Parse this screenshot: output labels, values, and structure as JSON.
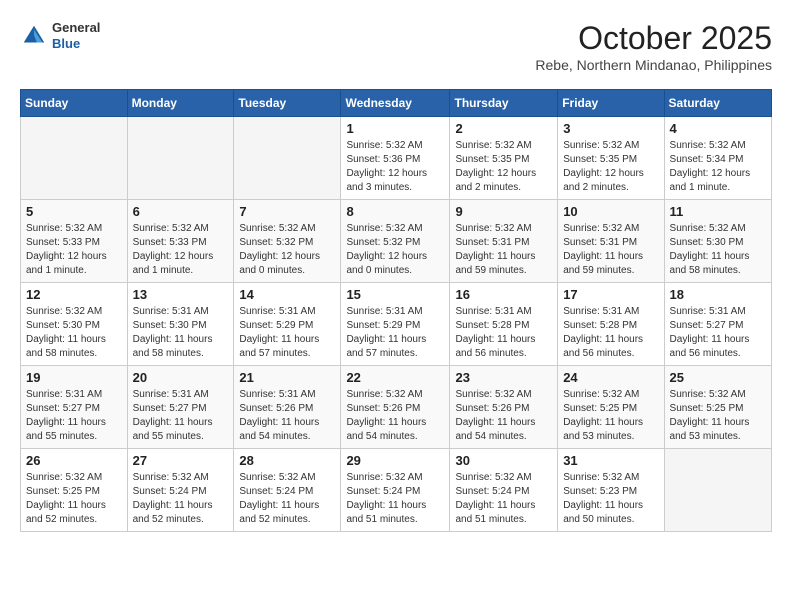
{
  "header": {
    "logo_general": "General",
    "logo_blue": "Blue",
    "month_year": "October 2025",
    "location": "Rebe, Northern Mindanao, Philippines"
  },
  "weekdays": [
    "Sunday",
    "Monday",
    "Tuesday",
    "Wednesday",
    "Thursday",
    "Friday",
    "Saturday"
  ],
  "weeks": [
    [
      {
        "day": "",
        "info": ""
      },
      {
        "day": "",
        "info": ""
      },
      {
        "day": "",
        "info": ""
      },
      {
        "day": "1",
        "info": "Sunrise: 5:32 AM\nSunset: 5:36 PM\nDaylight: 12 hours\nand 3 minutes."
      },
      {
        "day": "2",
        "info": "Sunrise: 5:32 AM\nSunset: 5:35 PM\nDaylight: 12 hours\nand 2 minutes."
      },
      {
        "day": "3",
        "info": "Sunrise: 5:32 AM\nSunset: 5:35 PM\nDaylight: 12 hours\nand 2 minutes."
      },
      {
        "day": "4",
        "info": "Sunrise: 5:32 AM\nSunset: 5:34 PM\nDaylight: 12 hours\nand 1 minute."
      }
    ],
    [
      {
        "day": "5",
        "info": "Sunrise: 5:32 AM\nSunset: 5:33 PM\nDaylight: 12 hours\nand 1 minute."
      },
      {
        "day": "6",
        "info": "Sunrise: 5:32 AM\nSunset: 5:33 PM\nDaylight: 12 hours\nand 1 minute."
      },
      {
        "day": "7",
        "info": "Sunrise: 5:32 AM\nSunset: 5:32 PM\nDaylight: 12 hours\nand 0 minutes."
      },
      {
        "day": "8",
        "info": "Sunrise: 5:32 AM\nSunset: 5:32 PM\nDaylight: 12 hours\nand 0 minutes."
      },
      {
        "day": "9",
        "info": "Sunrise: 5:32 AM\nSunset: 5:31 PM\nDaylight: 11 hours\nand 59 minutes."
      },
      {
        "day": "10",
        "info": "Sunrise: 5:32 AM\nSunset: 5:31 PM\nDaylight: 11 hours\nand 59 minutes."
      },
      {
        "day": "11",
        "info": "Sunrise: 5:32 AM\nSunset: 5:30 PM\nDaylight: 11 hours\nand 58 minutes."
      }
    ],
    [
      {
        "day": "12",
        "info": "Sunrise: 5:32 AM\nSunset: 5:30 PM\nDaylight: 11 hours\nand 58 minutes."
      },
      {
        "day": "13",
        "info": "Sunrise: 5:31 AM\nSunset: 5:30 PM\nDaylight: 11 hours\nand 58 minutes."
      },
      {
        "day": "14",
        "info": "Sunrise: 5:31 AM\nSunset: 5:29 PM\nDaylight: 11 hours\nand 57 minutes."
      },
      {
        "day": "15",
        "info": "Sunrise: 5:31 AM\nSunset: 5:29 PM\nDaylight: 11 hours\nand 57 minutes."
      },
      {
        "day": "16",
        "info": "Sunrise: 5:31 AM\nSunset: 5:28 PM\nDaylight: 11 hours\nand 56 minutes."
      },
      {
        "day": "17",
        "info": "Sunrise: 5:31 AM\nSunset: 5:28 PM\nDaylight: 11 hours\nand 56 minutes."
      },
      {
        "day": "18",
        "info": "Sunrise: 5:31 AM\nSunset: 5:27 PM\nDaylight: 11 hours\nand 56 minutes."
      }
    ],
    [
      {
        "day": "19",
        "info": "Sunrise: 5:31 AM\nSunset: 5:27 PM\nDaylight: 11 hours\nand 55 minutes."
      },
      {
        "day": "20",
        "info": "Sunrise: 5:31 AM\nSunset: 5:27 PM\nDaylight: 11 hours\nand 55 minutes."
      },
      {
        "day": "21",
        "info": "Sunrise: 5:31 AM\nSunset: 5:26 PM\nDaylight: 11 hours\nand 54 minutes."
      },
      {
        "day": "22",
        "info": "Sunrise: 5:32 AM\nSunset: 5:26 PM\nDaylight: 11 hours\nand 54 minutes."
      },
      {
        "day": "23",
        "info": "Sunrise: 5:32 AM\nSunset: 5:26 PM\nDaylight: 11 hours\nand 54 minutes."
      },
      {
        "day": "24",
        "info": "Sunrise: 5:32 AM\nSunset: 5:25 PM\nDaylight: 11 hours\nand 53 minutes."
      },
      {
        "day": "25",
        "info": "Sunrise: 5:32 AM\nSunset: 5:25 PM\nDaylight: 11 hours\nand 53 minutes."
      }
    ],
    [
      {
        "day": "26",
        "info": "Sunrise: 5:32 AM\nSunset: 5:25 PM\nDaylight: 11 hours\nand 52 minutes."
      },
      {
        "day": "27",
        "info": "Sunrise: 5:32 AM\nSunset: 5:24 PM\nDaylight: 11 hours\nand 52 minutes."
      },
      {
        "day": "28",
        "info": "Sunrise: 5:32 AM\nSunset: 5:24 PM\nDaylight: 11 hours\nand 52 minutes."
      },
      {
        "day": "29",
        "info": "Sunrise: 5:32 AM\nSunset: 5:24 PM\nDaylight: 11 hours\nand 51 minutes."
      },
      {
        "day": "30",
        "info": "Sunrise: 5:32 AM\nSunset: 5:24 PM\nDaylight: 11 hours\nand 51 minutes."
      },
      {
        "day": "31",
        "info": "Sunrise: 5:32 AM\nSunset: 5:23 PM\nDaylight: 11 hours\nand 50 minutes."
      },
      {
        "day": "",
        "info": ""
      }
    ]
  ]
}
